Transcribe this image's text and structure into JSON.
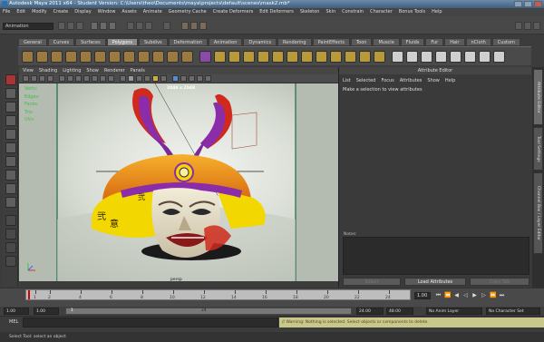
{
  "window": {
    "title": "Autodesk Maya 2011 x64 - Student Version: C:\\Users\\theo\\Documents\\maya\\projects\\default\\scenes\\mask2.mb*"
  },
  "menubar": {
    "items": [
      "File",
      "Edit",
      "Modify",
      "Create",
      "Display",
      "Window",
      "Assets",
      "Animate",
      "Geometry Cache",
      "Create Deformers",
      "Edit Deformers",
      "Skeleton",
      "Skin",
      "Constrain",
      "Character",
      "Bonus Tools",
      "Help"
    ]
  },
  "status_line": {
    "mode": "Animation"
  },
  "shelf": {
    "tabs": [
      "General",
      "Curves",
      "Surfaces",
      "Polygons",
      "Subdivs",
      "Deformation",
      "Animation",
      "Dynamics",
      "Rendering",
      "PaintEffects",
      "Toon",
      "Muscle",
      "Fluids",
      "Fur",
      "Hair",
      "nCloth",
      "Custom"
    ],
    "active_tab": "Polygons"
  },
  "viewport": {
    "menu": [
      "View",
      "Shading",
      "Lighting",
      "Show",
      "Renderer",
      "Panels"
    ],
    "headsup_labels": [
      "Verts:",
      "Edges:",
      "Faces:",
      "Tris:",
      "UVs:"
    ],
    "resolution": "2048 x 2048",
    "camera": "persp",
    "mask_characters": [
      "弐",
      "意",
      "弐"
    ]
  },
  "attribute_editor": {
    "title": "Attribute Editor",
    "menu": [
      "List",
      "Selected",
      "Focus",
      "Attributes",
      "Show",
      "Help"
    ],
    "message": "Make a selection to view attributes",
    "notes_label": "Notes:",
    "buttons": [
      "Select",
      "Load Attributes",
      "Copy Tab"
    ]
  },
  "side_tabs": [
    "Attribute Editor",
    "Tool Settings",
    "Channel Box / Layer Editor"
  ],
  "time_slider": {
    "ticks": [
      "1",
      "2",
      "4",
      "6",
      "8",
      "10",
      "12",
      "14",
      "16",
      "18",
      "20",
      "22",
      "24"
    ],
    "current_frame": "1.00"
  },
  "range_slider": {
    "start": "1.00",
    "start_inner": "1.00",
    "slider_left": "1",
    "slider_mid": "24",
    "end_inner": "24.00",
    "end": "48.00",
    "anim_layer": "No Anim Layer",
    "character_set": "No Character Set"
  },
  "command_line": {
    "label": "MEL",
    "warning": "// Warning: Nothing is selected. Select objects or components to delete."
  },
  "help_line": {
    "text": "Select Tool: select an object"
  },
  "colors": {
    "accent": "#d9a400",
    "helmet_yellow": "#f2d700",
    "helmet_orange": "#e77a1a",
    "helmet_purple": "#8b2ca8",
    "crest_red": "#cf2a1d",
    "warning_bg": "#c8c88a"
  }
}
